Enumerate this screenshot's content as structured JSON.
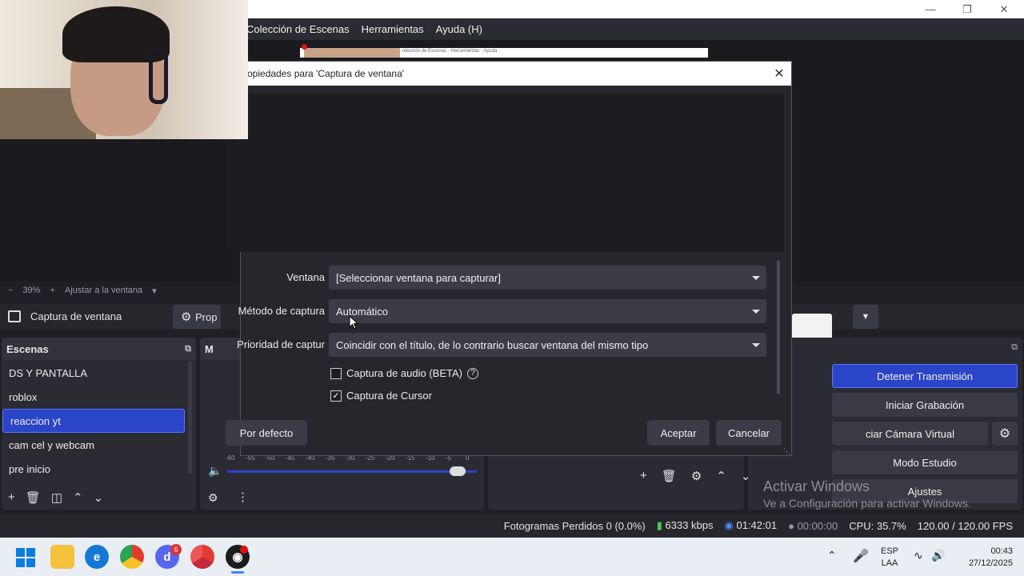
{
  "menu": [
    "Colección de Escenas",
    "Herramientas",
    "Ayuda (H)"
  ],
  "dialog": {
    "title": "opiedades para 'Captura de ventana'",
    "fields": [
      {
        "label": "Ventana",
        "value": "[Seleccionar ventana para capturar]"
      },
      {
        "label": "Método de captura",
        "value": "Automático"
      },
      {
        "label": "Prioridad de captur",
        "value": "Coincidir con el título, de lo contrario buscar ventana del mismo tipo"
      }
    ],
    "checkboxes": [
      {
        "label": "Captura de audio (BETA)",
        "checked": false
      },
      {
        "label": "Captura de Cursor",
        "checked": true
      }
    ],
    "defaults_button": "Por defecto",
    "accept_button": "Aceptar",
    "cancel_button": "Cancelar"
  },
  "zoom": {
    "percent": "39%",
    "fit_label": "Ajustar a la ventana"
  },
  "source_bar": {
    "source_name": "Captura de ventana",
    "properties_label": "Prop"
  },
  "scenes": {
    "title": "Escenas",
    "items": [
      "DS Y PANTALLA",
      "roblox",
      "reaccion yt",
      "cam cel y webcam",
      "pre inicio"
    ],
    "active_index": 2
  },
  "mixer": {
    "title": "M",
    "ticks": [
      "-60",
      "-55",
      "-50",
      "-45",
      "-40",
      "-35",
      "-30",
      "-25",
      "-20",
      "-15",
      "-10",
      "-5",
      "0"
    ],
    "volume_level": 0.95
  },
  "controls": {
    "stop_stream": "Detener Transmisión",
    "start_recording": "Iniciar Grabación",
    "virtual_camera": "ciar Cámara Virtual",
    "studio_mode": "Modo Estudio",
    "settings": "Ajustes"
  },
  "watermark": {
    "line1": "Activar Windows",
    "line2": "Ve a Configuración para activar Windows."
  },
  "status": {
    "dropped": "Fotogramas Perdidos 0 (0.0%)",
    "bitrate": "6333 kbps",
    "stream_time": "01:42:01",
    "rec_time": "00:00:00",
    "cpu": "CPU: 35.7%",
    "fps": "120.00 / 120.00 FPS"
  },
  "taskbar": {
    "lang_top": "ESP",
    "lang_bottom": "LAA",
    "time": "00:43",
    "date": "27/12/2025",
    "discord_badge": "6"
  }
}
